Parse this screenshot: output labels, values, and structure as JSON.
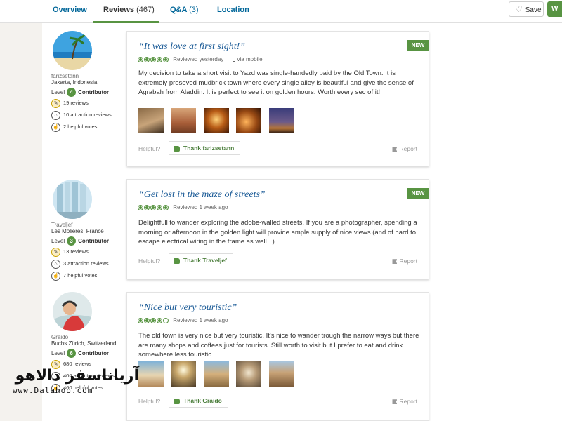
{
  "nav": {
    "tabs": [
      {
        "label": "Overview",
        "count": ""
      },
      {
        "label": "Reviews",
        "count": "(467)"
      },
      {
        "label": "Q&A",
        "count": "(3)"
      },
      {
        "label": "Location",
        "count": ""
      }
    ],
    "active_tab": "Reviews",
    "save_label": "Save",
    "write_label": "W"
  },
  "colors": {
    "accent_green": "#589442",
    "title_blue": "#1a5a96",
    "link_blue": "#069"
  },
  "reviews": [
    {
      "user": {
        "name": "farizsetann",
        "location": "Jakarta, Indonesia",
        "level_prefix": "Level",
        "level": "4",
        "level_suffix": "Contributor",
        "stats": [
          "19 reviews",
          "10 attraction reviews",
          "2 helpful votes"
        ]
      },
      "badge": "NEW",
      "title": "“It was love at first sight!”",
      "rating": 5,
      "date": "Reviewed yesterday",
      "via": "via mobile",
      "text": "My decision to take a short visit to Yazd was single-handedly paid by the Old Town. It is extremely preseved mudbrick town where every single alley is beautiful and give the sense of Agrabah from Aladdin. It is perfect to see it on golden hours. Worth every sec of it!",
      "photo_count": 5,
      "helpful_label": "Helpful?",
      "thank_label": "Thank farizsetann",
      "report_label": "Report"
    },
    {
      "user": {
        "name": "Traveljef",
        "location": "Les Molieres, France",
        "level_prefix": "Level",
        "level": "3",
        "level_suffix": "Contributor",
        "stats": [
          "13 reviews",
          "3 attraction reviews",
          "7 helpful votes"
        ]
      },
      "badge": "NEW",
      "title": "“Get lost in the maze of streets”",
      "rating": 5,
      "date": "Reviewed 1 week ago",
      "via": "",
      "text": "Delightfull to wander exploring the adobe-walled streets. If you are a photographer, spending a morning or afternoon in the golden light will provide ample supply of nice views (and of hard to escape electrical wiring in the frame as well...)",
      "photo_count": 0,
      "helpful_label": "Helpful?",
      "thank_label": "Thank Traveljef",
      "report_label": "Report"
    },
    {
      "user": {
        "name": "Graido",
        "location": "Buchs Zürich, Switzerland",
        "level_prefix": "Level",
        "level": "6",
        "level_suffix": "Contributor",
        "stats": [
          "680 reviews",
          "406 attraction reviews",
          "460 helpful votes"
        ]
      },
      "badge": "",
      "title": "“Nice but very touristic”",
      "rating": 4,
      "date": "Reviewed 1 week ago",
      "via": "",
      "text": "The old town is very nice but very touristic. It's nice to wander trough the narrow ways but there are many shops and coffees just for tourists. Still worth to visit but I prefer to eat and drink somewhere less touristic...",
      "photo_count": 5,
      "helpful_label": "Helpful?",
      "thank_label": "Thank Graido",
      "report_label": "Report"
    }
  ],
  "watermark": {
    "logo": "آریاناسفر دالاهو",
    "url": "www.Dalahoo.com"
  }
}
